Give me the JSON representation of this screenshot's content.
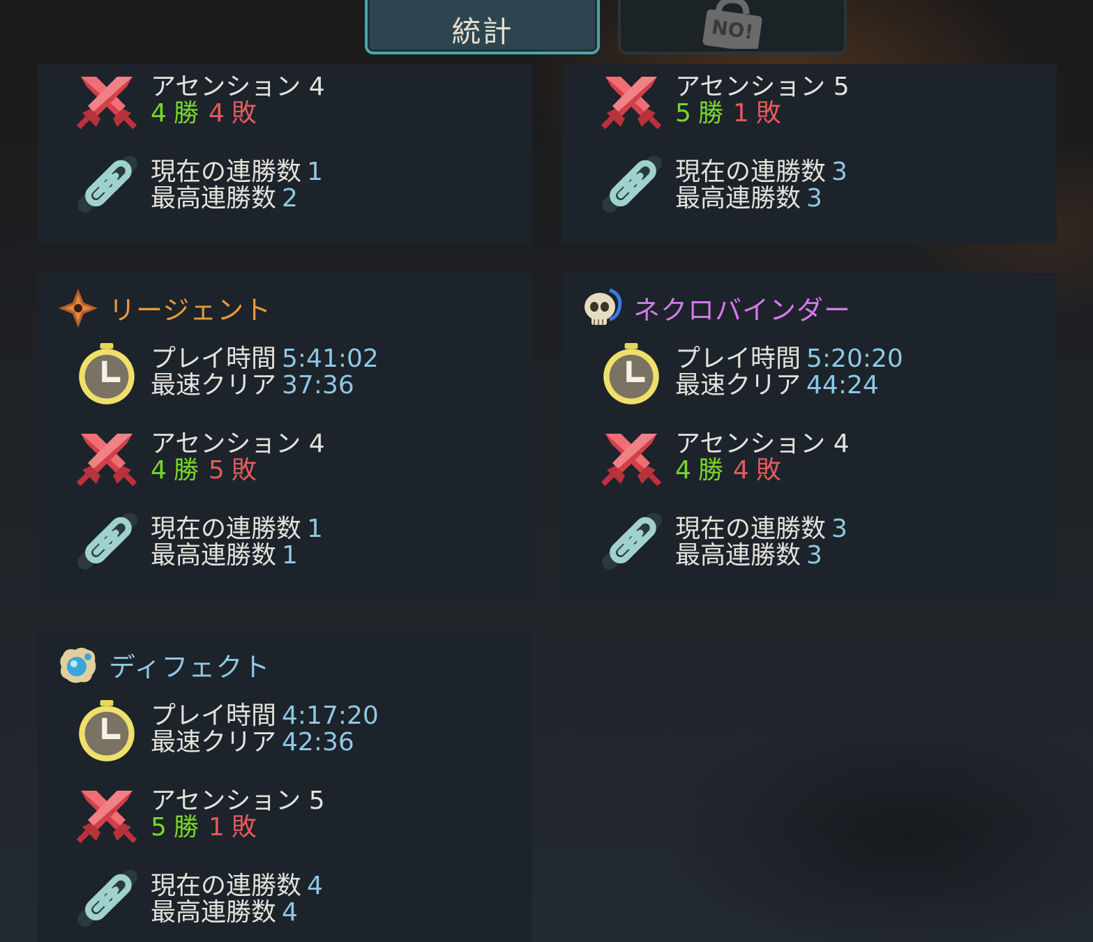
{
  "tabs": {
    "active_label": "統計",
    "locked_badge": "NO!"
  },
  "colors": {
    "regent": "#e79a3a",
    "necrobinder": "#d478f0",
    "defect": "#8fc8e4",
    "ascension": "#e45a5a",
    "win": "#7bd629",
    "value": "#8fc8e4"
  },
  "labels": {
    "playtime": "プレイ時間",
    "fastest": "最速クリア",
    "current_streak": "現在の連勝数",
    "best_streak": "最高連勝数",
    "win_suffix": "勝",
    "loss_suffix": "敗"
  },
  "panels": [
    {
      "ascension": "アセンション 4",
      "wins": "4",
      "losses": "4",
      "current_streak": "1",
      "best_streak": "2"
    },
    {
      "ascension": "アセンション 5",
      "wins": "5",
      "losses": "1",
      "current_streak": "3",
      "best_streak": "3"
    },
    {
      "name": "リージェント",
      "icon": "regent-crown-icon",
      "playtime": "5:41:02",
      "fastest": "37:36",
      "ascension": "アセンション 4",
      "wins": "4",
      "losses": "5",
      "current_streak": "1",
      "best_streak": "1"
    },
    {
      "name": "ネクロバインダー",
      "icon": "necrobinder-skull-icon",
      "playtime": "5:20:20",
      "fastest": "44:24",
      "ascension": "アセンション 4",
      "wins": "4",
      "losses": "4",
      "current_streak": "3",
      "best_streak": "3"
    },
    {
      "name": "ディフェクト",
      "icon": "defect-orb-icon",
      "playtime": "4:17:20",
      "fastest": "42:36",
      "ascension": "アセンション 5",
      "wins": "5",
      "losses": "1",
      "current_streak": "4",
      "best_streak": "4"
    }
  ]
}
